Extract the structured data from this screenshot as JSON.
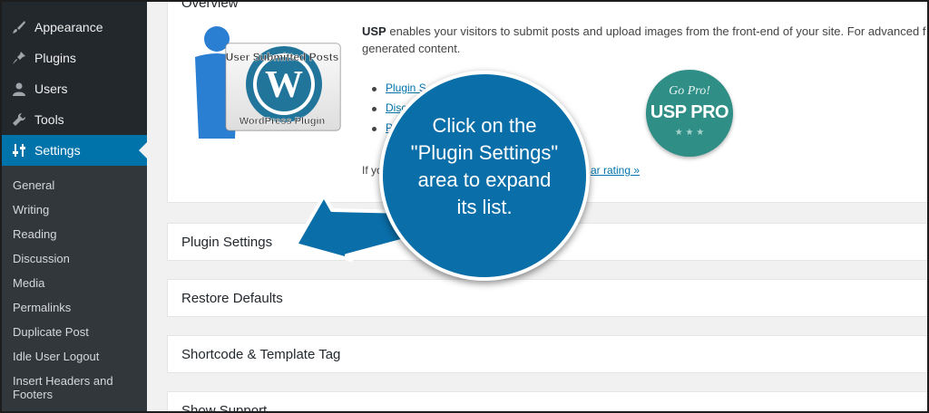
{
  "sidebar": {
    "menu": [
      {
        "label": "Appearance",
        "icon": "paintbrush-icon"
      },
      {
        "label": "Plugins",
        "icon": "plugin-icon"
      },
      {
        "label": "Users",
        "icon": "user-icon"
      },
      {
        "label": "Tools",
        "icon": "wrench-icon"
      },
      {
        "label": "Settings",
        "icon": "settings-sliders-icon",
        "active": true
      }
    ],
    "submenu": [
      "General",
      "Writing",
      "Reading",
      "Discussion",
      "Media",
      "Permalinks",
      "Duplicate Post",
      "Idle User Logout",
      "Insert Headers and Footers"
    ]
  },
  "overview": {
    "title": "Overview",
    "description_bold": "USP",
    "description_rest": " enables your visitors to submit posts and upload images from the front-end of your site. For advanced f",
    "description_line2": "generated content.",
    "banner_line1": "User Submitted Posts",
    "banner_line2": "WordPress Plugin",
    "links": [
      "Plugin S",
      "Disc",
      "P"
    ],
    "footer_prefix": "If yo",
    "footer_link": "ar rating »",
    "promo": {
      "line1": "Go Pro!",
      "line2": "USP PRO",
      "stars": "★ ★ ★"
    }
  },
  "sections": [
    {
      "title": "Plugin Settings"
    },
    {
      "title": "Restore Defaults"
    },
    {
      "title": "Shortcode & Template Tag"
    },
    {
      "title": "Show Support"
    }
  ],
  "callout": {
    "lines": [
      "Click on the",
      "\"Plugin Settings\"",
      "area to expand",
      "its list."
    ]
  },
  "colors": {
    "sidebar_bg": "#23282d",
    "submenu_bg": "#32373c",
    "accent": "#0073aa",
    "callout": "#0a6ea8",
    "promo_badge": "#2f8f87"
  }
}
